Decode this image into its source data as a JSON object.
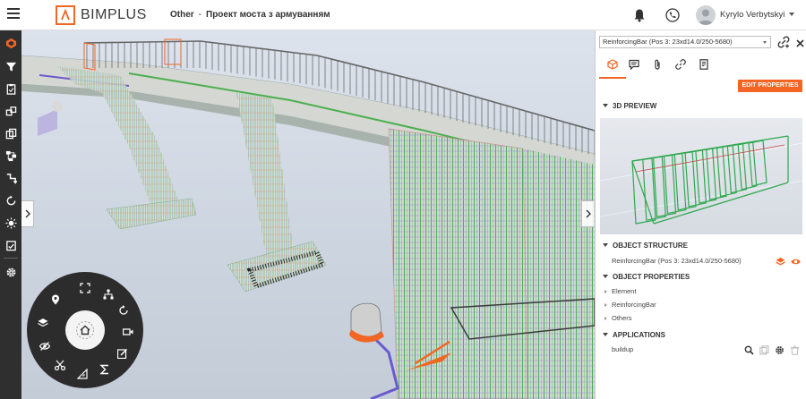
{
  "header": {
    "logo_text": "BIMPLUS",
    "breadcrumb_project": "Other",
    "breadcrumb_separator": "-",
    "breadcrumb_model": "Проект моста з армуванням",
    "user_name": "Kyrylo Verbytskyi"
  },
  "left_toolbar": {
    "items": [
      "bimplus-logo-icon",
      "filter-icon",
      "clipboard-icon",
      "layers-icon",
      "copy-icon",
      "hierarchy-icon",
      "sort-icon",
      "rotate-icon",
      "sun-icon",
      "checklist-icon",
      "gear-icon"
    ]
  },
  "radial_menu": {
    "items": [
      "home-icon",
      "fullscreen-icon",
      "network-icon",
      "rotate-icon",
      "video-icon",
      "edit-icon",
      "sigma-icon",
      "measure-icon",
      "scissors-icon",
      "visibility-icon",
      "layers-icon",
      "location-icon"
    ]
  },
  "panel": {
    "selected_object": "ReinforcingBar (Pos 3: 23xd14.0/250-5680)",
    "edit_properties_label": "EDIT PROPERTIES",
    "tabs": [
      "cube-icon",
      "comment-icon",
      "attachment-icon",
      "link-icon",
      "document-icon"
    ],
    "preview_title": "3D PREVIEW",
    "structure_title": "OBJECT STRUCTURE",
    "structure_item": "ReinforcingBar (Pos 3: 23xd14.0/250-5680)",
    "properties_title": "OBJECT PROPERTIES",
    "properties_items": [
      "Element",
      "ReinforcingBar",
      "Others"
    ],
    "applications_title": "APPLICATIONS",
    "application_item": "buildup"
  },
  "colors": {
    "accent": "#f26522",
    "toolbar_bg": "#2f2f2f",
    "rebar_green": "#2fa84f"
  }
}
